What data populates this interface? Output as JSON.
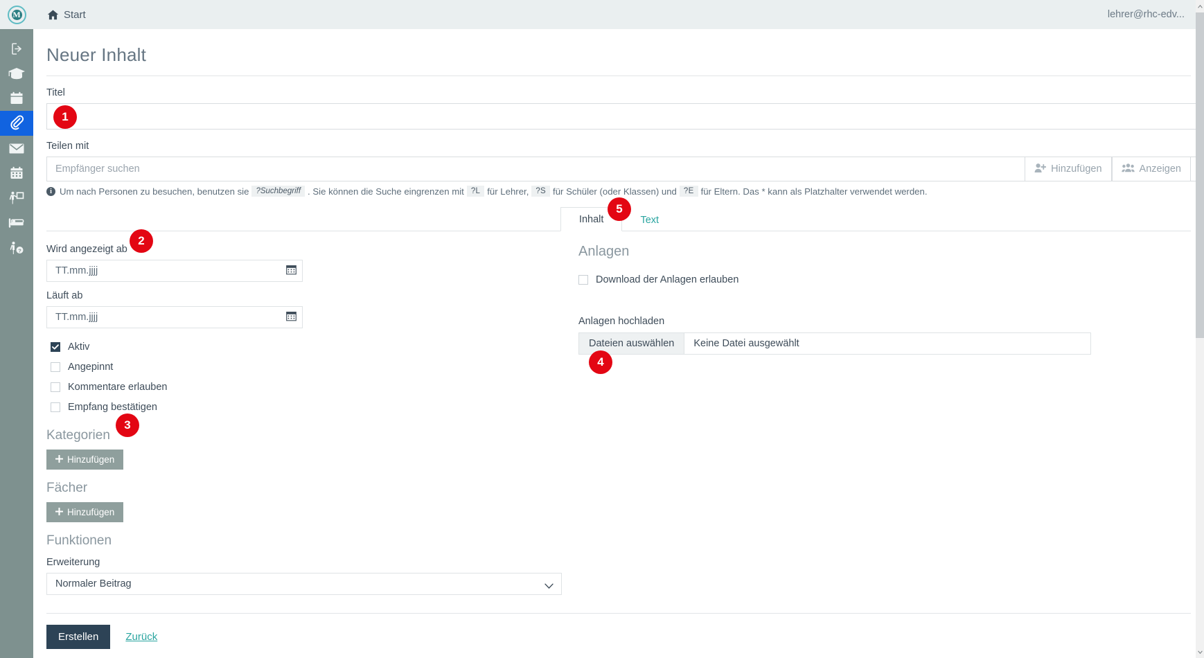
{
  "topbar": {
    "logo_letter": "M",
    "start_label": "Start",
    "user_email": "lehrer@rhc-edv..."
  },
  "sidebar": {
    "items": [
      {
        "icon": "logout-icon",
        "active": false
      },
      {
        "icon": "graduation-cap-icon",
        "active": false
      },
      {
        "icon": "calendar-icon",
        "active": false
      },
      {
        "icon": "paperclip-icon",
        "active": true
      },
      {
        "icon": "envelope-icon",
        "active": false
      },
      {
        "icon": "calendar-grid-icon",
        "active": false
      },
      {
        "icon": "teacher-board-icon",
        "active": false
      },
      {
        "icon": "bed-icon",
        "active": false
      },
      {
        "icon": "person-question-icon",
        "active": false
      }
    ]
  },
  "page": {
    "title": "Neuer Inhalt"
  },
  "title_field": {
    "label": "Titel",
    "value": "",
    "placeholder": ""
  },
  "share": {
    "label": "Teilen mit",
    "placeholder": "Empfänger suchen",
    "value": "",
    "add_button": "Hinzufügen",
    "show_button": "Anzeigen",
    "hint": {
      "part1": "Um nach Personen zu besuchen, benutzen sie",
      "code1": "?Suchbegriff",
      "part2": ". Sie können die Suche eingrenzen mit",
      "code2": "?L",
      "part3": "für Lehrer,",
      "code3": "?S",
      "part4": "für Schüler (oder Klassen) und",
      "code4": "?E",
      "part5": "für Eltern. Das * kann als Platzhalter verwendet werden."
    }
  },
  "tabs": [
    {
      "label": "Inhalt",
      "active": true
    },
    {
      "label": "Text",
      "active": false
    }
  ],
  "content_panel": {
    "show_from": {
      "label": "Wird angezeigt ab",
      "placeholder": "TT.mm.jjjj",
      "value": ""
    },
    "expires": {
      "label": "Läuft ab",
      "placeholder": "TT.mm.jjjj",
      "value": ""
    },
    "checkboxes": [
      {
        "label": "Aktiv",
        "checked": true
      },
      {
        "label": "Angepinnt",
        "checked": false
      },
      {
        "label": "Kommentare erlauben",
        "checked": false
      },
      {
        "label": "Empfang bestätigen",
        "checked": false
      }
    ],
    "categories": {
      "heading": "Kategorien",
      "add_button": "Hinzufügen"
    },
    "subjects": {
      "heading": "Fächer",
      "add_button": "Hinzufügen"
    },
    "functions": {
      "heading": "Funktionen",
      "extension_label": "Erweiterung",
      "extension_value": "Normaler Beitrag",
      "extension_options": [
        "Normaler Beitrag"
      ]
    },
    "attachments": {
      "heading": "Anlagen",
      "allow_download_label": "Download der Anlagen erlauben",
      "allow_download_checked": false,
      "upload_label": "Anlagen hochladen",
      "file_button": "Dateien auswählen",
      "file_status": "Keine Datei ausgewählt"
    }
  },
  "footer": {
    "submit_label": "Erstellen",
    "back_label": "Zurück"
  },
  "callouts": [
    {
      "number": "1"
    },
    {
      "number": "2"
    },
    {
      "number": "3"
    },
    {
      "number": "4"
    },
    {
      "number": "5"
    }
  ],
  "colors": {
    "accent_teal": "#2aa5a0",
    "sidebar_bg": "#7e918f",
    "sidebar_active": "#1163e0",
    "primary_btn": "#2d4356",
    "callout_red": "#e30613"
  }
}
